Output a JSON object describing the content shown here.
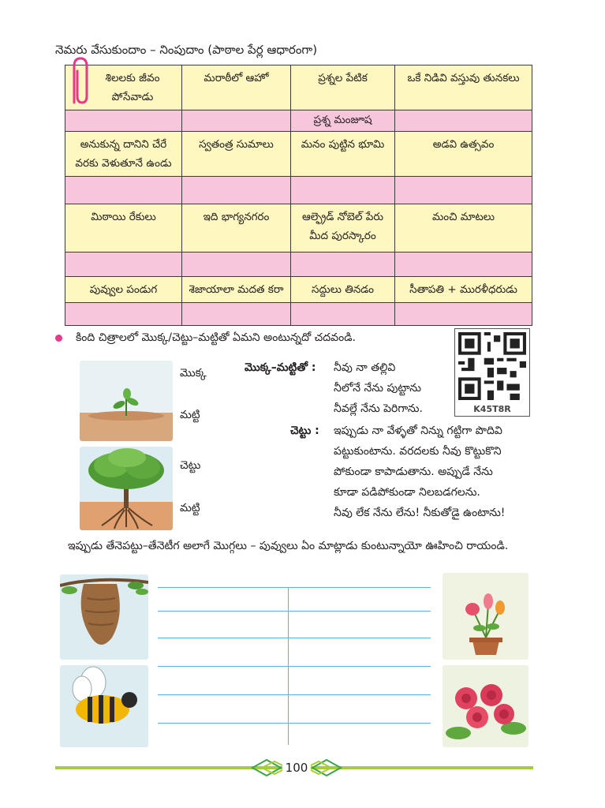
{
  "title": "నెమరు వేసుకుందాం – నింపుదాం (పాఠాల పేర్ల ఆధారంగా)",
  "table": {
    "rows": [
      [
        "శిలలకు జీవం పోసేవాడు",
        "మరాఠీలో ఆహో",
        "ప్రశ్నల పేటిక",
        "ఒకే నిడివి వస్తువు తునకలు"
      ],
      [
        "",
        "",
        "ప్రశ్న మంజూష",
        ""
      ],
      [
        "అనుకున్న దానిని చేరే వరకు వెళుతూనే ఉండు",
        "స్వతంత్ర సుమాలు",
        "మనం పుట్టిన భూమి",
        "అడవి ఉత్సవం"
      ],
      [
        "",
        "",
        "",
        ""
      ],
      [
        "మిఠాయి రేకులు",
        "ఇది భాగ్యనగరం",
        "ఆల్ఫ్రెడ్ నోబెల్ పేరు మీద పురస్కారం",
        "మంచి మాటలు"
      ],
      [
        "",
        "",
        "",
        ""
      ],
      [
        "పువ్వుల పండుగ",
        "శెజాయాలా మదత కరా",
        "సద్దులు తినడం",
        "సీతాపతి + మురళీధరుడు"
      ],
      [
        "",
        "",
        "",
        ""
      ]
    ]
  },
  "instruction1": "కింది చిత్రాలలో మొక్క/చెట్టు–మట్టితో ఏమని అంటున్నదో చదవండి.",
  "qr_code": "K45T8R",
  "picture_labels": {
    "sapling": "మొక్క",
    "soil1": "మట్టి",
    "tree": "చెట్టు",
    "soil2": "మట్టి"
  },
  "dialogue": {
    "speaker1": "మొక్క–మట్టితో :",
    "lines1": [
      "నీవు నా తల్లివి",
      "నీలోనే నేను పుట్టాను",
      "నీవల్లే నేను పెరిగాను."
    ],
    "speaker2": "చెట్టు :",
    "lines2": [
      "ఇప్పుడు నా వేళ్ళతో నిన్ను గట్టిగా పొదివి",
      "పట్టుకుంటాను. వరదలకు నీవు కొట్టుకొని",
      "పోకుండా కాపాడుతాను. అప్పుడే నేను",
      "కూడా పడిపోకుండా నిలబడగలను.",
      "నీవు లేక నేను లేను! నీకుతోడై ఉంటాను!"
    ]
  },
  "instruction2": "ఇప్పుడు తేనెపట్టు–తేనెటీగ అలాగే మొగ్గలు – పువ్వులు ఏం మాట్లాడు కుంటున్నాయో ఊహించి రాయండి.",
  "page_number": "100",
  "colors": {
    "table_yellow": "#fff7c0",
    "table_pink": "#f7c6dc",
    "bullet_pink": "#e8388a",
    "writing_lines": "#5ab4e6",
    "footer_green": "#a6cc3c"
  }
}
